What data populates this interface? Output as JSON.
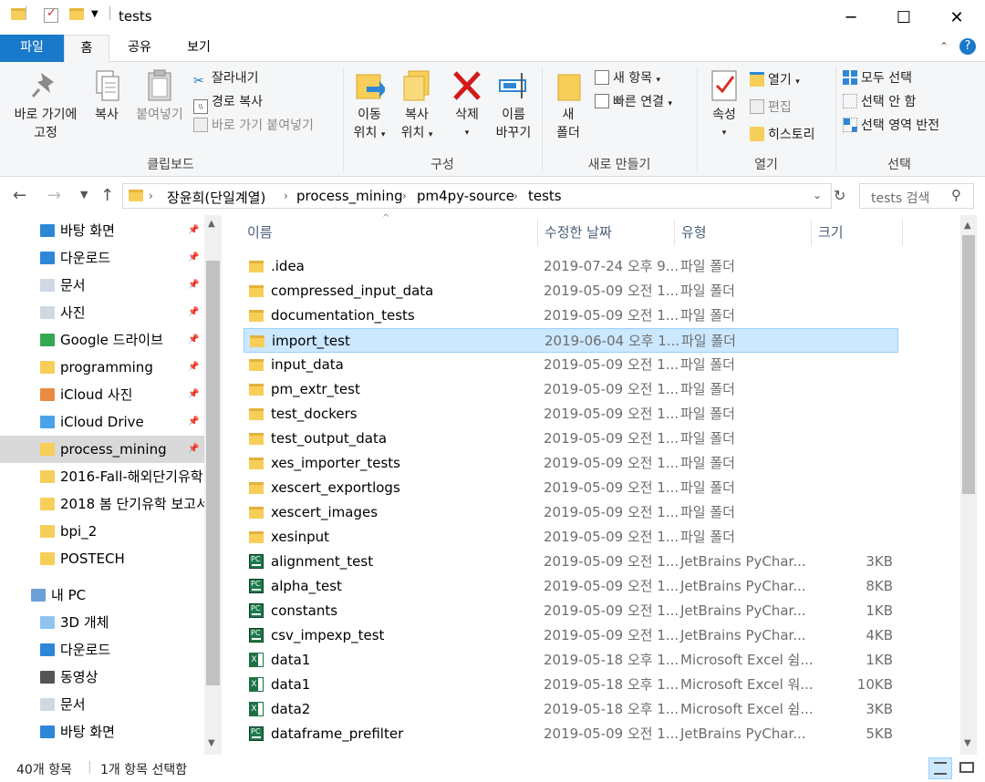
{
  "window": {
    "title": "tests",
    "minimize": "─",
    "maximize": "☐",
    "close": "✕"
  },
  "tabs": [
    "파일",
    "홈",
    "공유",
    "보기"
  ],
  "ribbon": {
    "clipboard": {
      "pin_label_1": "바로 가기에",
      "pin_label_2": "고정",
      "copy": "복사",
      "paste": "붙여넣기",
      "cut": "잘라내기",
      "copy_path": "경로 복사",
      "paste_shortcut": "바로 가기 붙여넣기",
      "group": "클립보드"
    },
    "organize": {
      "move_1": "이동",
      "move_2": "위치",
      "copyto_1": "복사",
      "copyto_2": "위치",
      "delete": "삭제",
      "rename_1": "이름",
      "rename_2": "바꾸기",
      "group": "구성"
    },
    "new": {
      "newfolder_1": "새",
      "newfolder_2": "폴더",
      "new_item": "새 항목",
      "easy_access": "빠른 연결",
      "group": "새로 만들기"
    },
    "open": {
      "properties": "속성",
      "open": "열기",
      "edit": "편집",
      "history": "히스토리",
      "group": "열기"
    },
    "select": {
      "select_all": "모두 선택",
      "select_none": "선택 안 함",
      "invert": "선택 영역 반전",
      "group": "선택"
    }
  },
  "address": {
    "crumbs": [
      "장윤희(단일계열)",
      "process_mining",
      "pm4py-source",
      "tests"
    ],
    "search_placeholder": "tests 검색"
  },
  "nav": [
    {
      "label": "바탕 화면",
      "pinned": true
    },
    {
      "label": "다운로드",
      "pinned": true
    },
    {
      "label": "문서",
      "pinned": true
    },
    {
      "label": "사진",
      "pinned": true
    },
    {
      "label": "Google 드라이브",
      "pinned": true
    },
    {
      "label": "programming",
      "pinned": true
    },
    {
      "label": "iCloud 사진",
      "pinned": true
    },
    {
      "label": "iCloud Drive",
      "pinned": true
    },
    {
      "label": "process_mining",
      "pinned": true
    },
    {
      "label": "2016-Fall-해외단기유학",
      "pinned": false
    },
    {
      "label": "2018 봄 단기유학 보고서",
      "pinned": false
    },
    {
      "label": "bpi_2",
      "pinned": false
    },
    {
      "label": "POSTECH",
      "pinned": false
    },
    {
      "label": "내 PC",
      "pinned": false
    },
    {
      "label": "3D 개체",
      "pinned": false
    },
    {
      "label": "다운로드",
      "pinned": false
    },
    {
      "label": "동영상",
      "pinned": false
    },
    {
      "label": "문서",
      "pinned": false
    },
    {
      "label": "바탕 화면",
      "pinned": false
    }
  ],
  "columns": {
    "name": "이름",
    "date": "수정한 날짜",
    "type": "유형",
    "size": "크기"
  },
  "files": [
    {
      "name": ".idea",
      "date": "2019-07-24 오후 9...",
      "type": "파일 폴더",
      "size": "",
      "kind": "folder"
    },
    {
      "name": "compressed_input_data",
      "date": "2019-05-09 오전 1...",
      "type": "파일 폴더",
      "size": "",
      "kind": "folder"
    },
    {
      "name": "documentation_tests",
      "date": "2019-05-09 오전 1...",
      "type": "파일 폴더",
      "size": "",
      "kind": "folder"
    },
    {
      "name": "import_test",
      "date": "2019-06-04 오후 1...",
      "type": "파일 폴더",
      "size": "",
      "kind": "folder"
    },
    {
      "name": "input_data",
      "date": "2019-05-09 오전 1...",
      "type": "파일 폴더",
      "size": "",
      "kind": "folder"
    },
    {
      "name": "pm_extr_test",
      "date": "2019-05-09 오전 1...",
      "type": "파일 폴더",
      "size": "",
      "kind": "folder"
    },
    {
      "name": "test_dockers",
      "date": "2019-05-09 오전 1...",
      "type": "파일 폴더",
      "size": "",
      "kind": "folder"
    },
    {
      "name": "test_output_data",
      "date": "2019-05-09 오전 1...",
      "type": "파일 폴더",
      "size": "",
      "kind": "folder"
    },
    {
      "name": "xes_importer_tests",
      "date": "2019-05-09 오전 1...",
      "type": "파일 폴더",
      "size": "",
      "kind": "folder"
    },
    {
      "name": "xescert_exportlogs",
      "date": "2019-05-09 오전 1...",
      "type": "파일 폴더",
      "size": "",
      "kind": "folder"
    },
    {
      "name": "xescert_images",
      "date": "2019-05-09 오전 1...",
      "type": "파일 폴더",
      "size": "",
      "kind": "folder"
    },
    {
      "name": "xesinput",
      "date": "2019-05-09 오전 1...",
      "type": "파일 폴더",
      "size": "",
      "kind": "folder"
    },
    {
      "name": "alignment_test",
      "date": "2019-05-09 오전 1...",
      "type": "JetBrains PyChar...",
      "size": "3KB",
      "kind": "py"
    },
    {
      "name": "alpha_test",
      "date": "2019-05-09 오전 1...",
      "type": "JetBrains PyChar...",
      "size": "8KB",
      "kind": "py"
    },
    {
      "name": "constants",
      "date": "2019-05-09 오전 1...",
      "type": "JetBrains PyChar...",
      "size": "1KB",
      "kind": "py"
    },
    {
      "name": "csv_impexp_test",
      "date": "2019-05-09 오전 1...",
      "type": "JetBrains PyChar...",
      "size": "4KB",
      "kind": "py"
    },
    {
      "name": "data1",
      "date": "2019-05-18 오후 1...",
      "type": "Microsoft Excel 쉼...",
      "size": "1KB",
      "kind": "xl"
    },
    {
      "name": "data1",
      "date": "2019-05-18 오후 1...",
      "type": "Microsoft Excel 워...",
      "size": "10KB",
      "kind": "xl"
    },
    {
      "name": "data2",
      "date": "2019-05-18 오후 1...",
      "type": "Microsoft Excel 쉼...",
      "size": "3KB",
      "kind": "xl"
    },
    {
      "name": "dataframe_prefilter",
      "date": "2019-05-09 오전 1...",
      "type": "JetBrains PyChar...",
      "size": "5KB",
      "kind": "py"
    }
  ],
  "status": {
    "count": "40개 항목",
    "selected": "1개 항목 선택함"
  }
}
